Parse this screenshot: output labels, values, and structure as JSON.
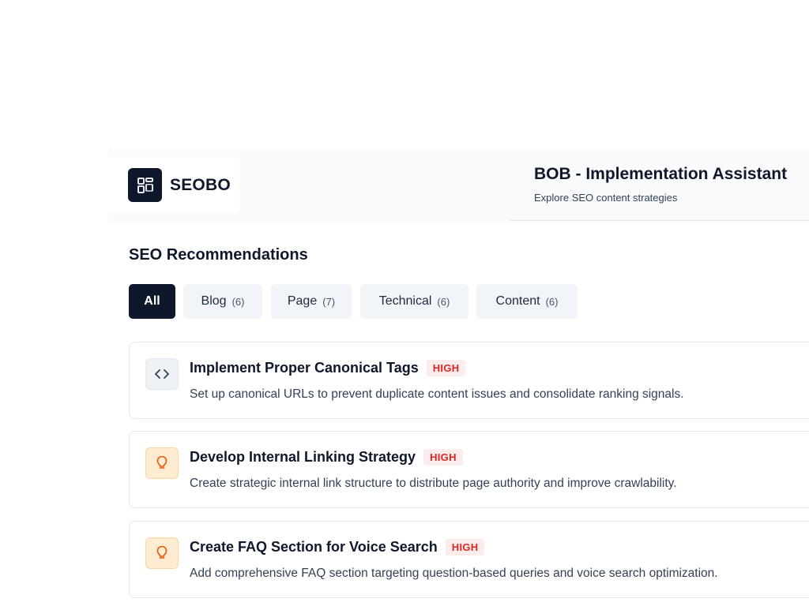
{
  "brand": {
    "name": "SEOBO",
    "logo_icon": "grid-layout-icon"
  },
  "header": {
    "title": "BOB - Implementation Assistant",
    "subtitle": "Explore SEO content strategies"
  },
  "section": {
    "title": "SEO Recommendations"
  },
  "tabs": [
    {
      "label": "All",
      "count": "",
      "active": true
    },
    {
      "label": "Blog",
      "count": "(6)",
      "active": false
    },
    {
      "label": "Page",
      "count": "(7)",
      "active": false
    },
    {
      "label": "Technical",
      "count": "(6)",
      "active": false
    },
    {
      "label": "Content",
      "count": "(6)",
      "active": false
    }
  ],
  "recommendations": [
    {
      "icon": "code-icon",
      "title": "Implement Proper Canonical Tags",
      "priority": "HIGH",
      "description": "Set up canonical URLs to prevent duplicate content issues and consolidate ranking signals."
    },
    {
      "icon": "lightbulb-icon",
      "title": "Develop Internal Linking Strategy",
      "priority": "HIGH",
      "description": "Create strategic internal link structure to distribute page authority and improve crawlability."
    },
    {
      "icon": "lightbulb-icon",
      "title": "Create FAQ Section for Voice Search",
      "priority": "HIGH",
      "description": "Add comprehensive FAQ section targeting question-based queries and voice search optimization."
    }
  ],
  "colors": {
    "primary": "#0f172a",
    "badge_text": "#dc2626",
    "badge_bg": "#fdecec",
    "bulb_icon": "#ea580c",
    "bulb_bg": "#fdebd2"
  }
}
